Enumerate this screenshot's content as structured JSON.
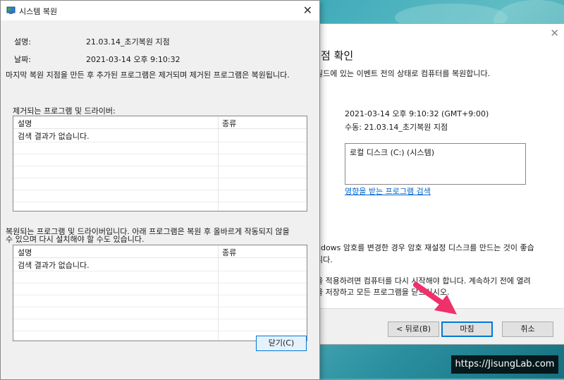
{
  "back_window": {
    "title_fragment": "점 확인",
    "line1": "필드에 있는 이벤트 전의 상태로 컴퓨터를 복원합니다.",
    "datetime": "2021-03-14 오후 9:10:32 (GMT+9:00)",
    "description": "수동: 21.03.14_초기복원 지점",
    "drives_item": "로컬 디스크 (C:) (시스템)",
    "scan_link": "영향을 받는 프로그램 검색",
    "note1": "ndows 암호를 변경한 경우 암호 재설정 디스크를 만드는 것이 좋습",
    "note2": "니다.",
    "note3": "을 적용하려면 컴퓨터를 다시 시작해야 합니다. 계속하기 전에 열려",
    "note4": "을 저장하고 모든 프로그램을 닫으십시오.",
    "buttons": {
      "back": "< 뒤로(B)",
      "finish": "마침",
      "cancel": "취소"
    }
  },
  "front_window": {
    "title": "시스템 복원",
    "desc_label": "설명:",
    "desc_value": "21.03.14_초기복원 지점",
    "date_label": "날짜:",
    "date_value": "2021-03-14 오후 9:10:32",
    "info_text": "마지막 복원 지점을 만든 후 추가된 프로그램은 제거되며 제거된 프로그램은 복원됩니다.",
    "removed_heading": "제거되는 프로그램 및 드라이버:",
    "restored_heading_1": "복원되는 프로그램 및 드라이버입니다. 아래 프로그램은 복원 후 올바르게 작동되지 않을",
    "restored_heading_2": "수 있으며 다시 설치해야 할 수도 있습니다.",
    "table_col_desc": "설명",
    "table_col_type": "종류",
    "empty_text": "검색 결과가 없습니다.",
    "close_button": "닫기(C)"
  },
  "watermark": "https://JisungLab.com",
  "colors": {
    "accent": "#0078d7",
    "arrow": "#f0306a",
    "link": "#0066cc"
  }
}
